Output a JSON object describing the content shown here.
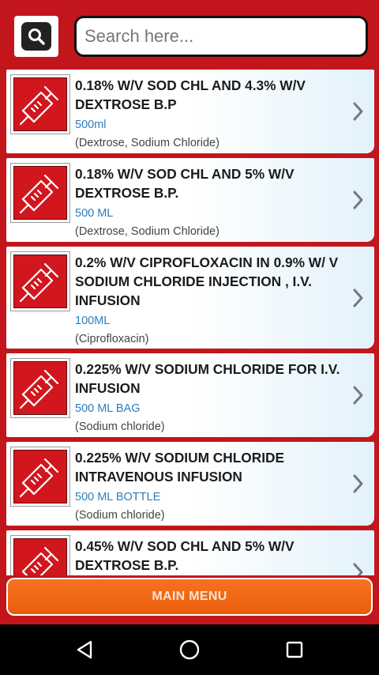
{
  "search": {
    "placeholder": "Search here..."
  },
  "items": [
    {
      "title": "0.18% W/V SOD CHL AND 4.3% W/V DEXTROSE B.P",
      "quantity": "500ml",
      "ingredients": "(Dextrose, Sodium Chloride)"
    },
    {
      "title": "0.18% W/V SOD CHL AND 5% W/V DEXTROSE B.P.",
      "quantity": "500 ML",
      "ingredients": "(Dextrose, Sodium Chloride)"
    },
    {
      "title": "0.2% W/V CIPROFLOXACIN IN 0.9% W/ V SODIUM CHLORIDE INJECTION , I.V. INFUSION",
      "quantity": "100ML",
      "ingredients": "(Ciprofloxacin)"
    },
    {
      "title": "0.225% W/V SODIUM CHLORIDE FOR I.V. INFUSION",
      "quantity": "500 ML BAG",
      "ingredients": "(Sodium chloride)"
    },
    {
      "title": "0.225% W/V SODIUM CHLORIDE INTRAVENOUS INFUSION",
      "quantity": "500 ML BOTTLE",
      "ingredients": "(Sodium chloride)"
    },
    {
      "title": "0.45% W/V SOD CHL AND 5% W/V DEXTROSE B.P.",
      "quantity": "",
      "ingredients": ""
    }
  ],
  "main_menu_label": "MAIN MENU",
  "icons": {
    "search": "search-icon",
    "item": "syringe-icon",
    "chevron": "chevron-right-icon",
    "nav_back": "back-icon",
    "nav_home": "home-icon",
    "nav_recent": "recent-apps-icon"
  },
  "colors": {
    "background": "#c3161c",
    "accent": "#f26a1b",
    "quantity_text": "#2d7dbb"
  }
}
